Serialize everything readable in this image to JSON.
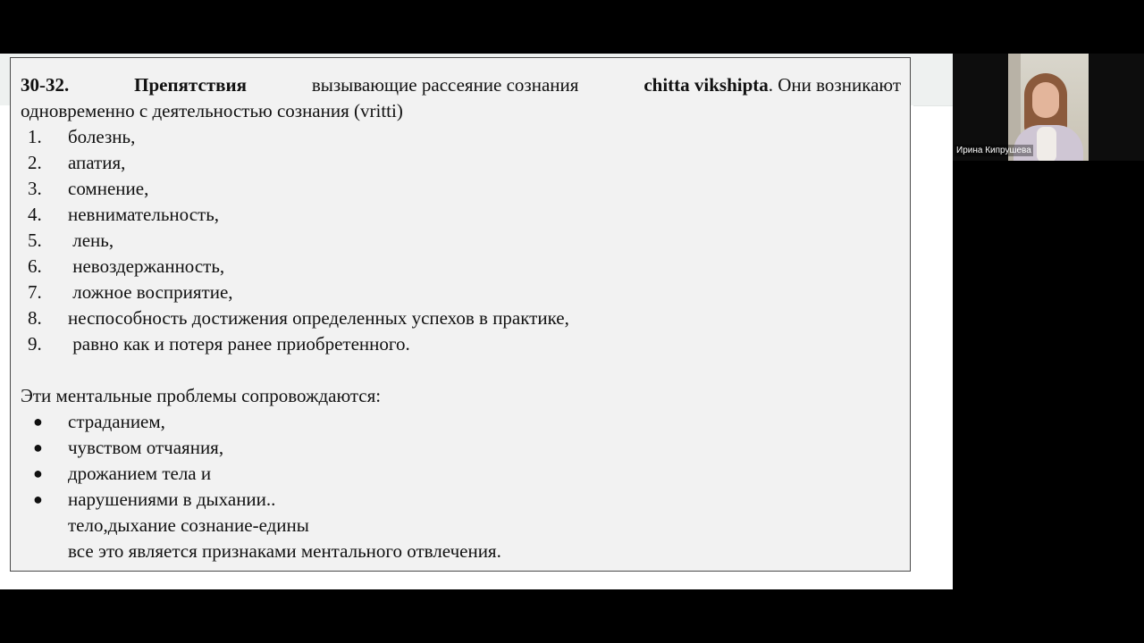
{
  "slide": {
    "heading": {
      "number": "30-32.",
      "bold_term": "Препятствия",
      "text_part1": "вызывающие рассеяние сознания",
      "bold_sanskrit": "chitta vikshipta",
      "text_part2": ". Они возникают",
      "line2": "одновременно с деятельностью сознания (vritti)"
    },
    "obstacles": [
      {
        "num": "1.",
        "text": "болезнь,"
      },
      {
        "num": "2.",
        "text": "апатия,"
      },
      {
        "num": "3.",
        "text": "сомнение,"
      },
      {
        "num": "4.",
        "text": "невнимательность,"
      },
      {
        "num": "5.",
        "text": " лень,"
      },
      {
        "num": "6.",
        "text": " невоздержанность,"
      },
      {
        "num": "7.",
        "text": " ложное восприятие,"
      },
      {
        "num": "8.",
        "text": "неспособность достижения определенных успехов в практике,"
      },
      {
        "num": "9.",
        "text": " равно как и потеря ранее приобретенного."
      }
    ],
    "consequences_intro": "Эти ментальные проблемы сопровождаются:",
    "bullet_symbol": "●",
    "consequences": [
      "страданием,",
      "чувством отчаяния,",
      "дрожанием тела и",
      "нарушениями в дыхании.."
    ],
    "closing_lines": [
      "тело,дыхание сознание-едины",
      "все это является признаками ментального отвлечения."
    ]
  },
  "participant": {
    "name": "Ирина Кипрушева"
  }
}
